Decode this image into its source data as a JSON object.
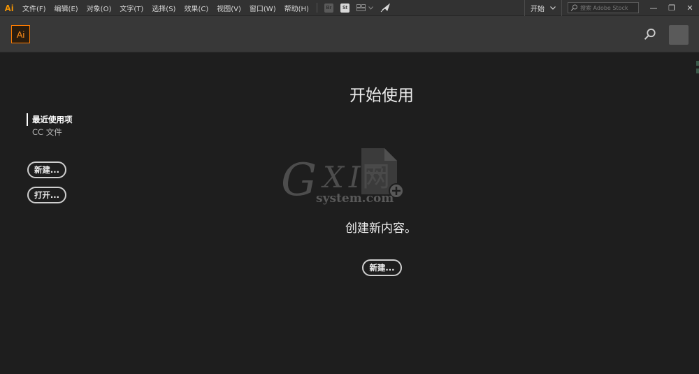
{
  "app": {
    "logo_small": "Ai",
    "logo": "Ai"
  },
  "menubar": {
    "items": [
      "文件(F)",
      "编辑(E)",
      "对象(O)",
      "文字(T)",
      "选择(S)",
      "效果(C)",
      "视图(V)",
      "窗口(W)",
      "帮助(H)"
    ],
    "bridge_label": "Br",
    "stock_label": "St",
    "workspace": "开始",
    "search_placeholder": "搜索 Adobe Stock",
    "minimize": "—",
    "restore": "❐",
    "close": "✕"
  },
  "sidebar": {
    "tabs": [
      {
        "label": "最近使用项",
        "active": true
      },
      {
        "label": "CC 文件",
        "active": false
      }
    ],
    "new_button": "新建...",
    "open_button": "打开..."
  },
  "main": {
    "title": "开始使用",
    "empty_message": "创建新内容。",
    "new_button": "新建..."
  },
  "watermark": {
    "g": "G",
    "xi": "XI",
    "wang": "网",
    "system": "system.com"
  },
  "colors": {
    "accent_orange": "#ff7c00",
    "background": "#1e1e1e",
    "menubar": "#323232",
    "header": "#383838"
  },
  "icons": [
    "bridge-icon",
    "stock-icon",
    "layout-icon",
    "gpu-rocket-icon",
    "search-icon",
    "avatar",
    "document-add-icon"
  ]
}
